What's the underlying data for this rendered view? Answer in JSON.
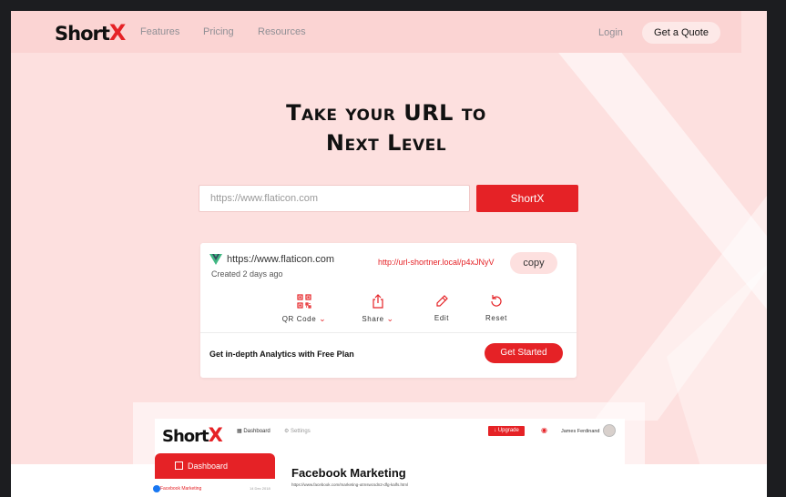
{
  "nav": {
    "logo_text": "Short",
    "logo_x": "X",
    "links": [
      "Features",
      "Pricing",
      "Resources"
    ],
    "login": "Login",
    "quote": "Get a Quote"
  },
  "hero": {
    "title_line1": "Take your URL to",
    "title_line2": "Next Level",
    "input_placeholder": "https://www.flaticon.com",
    "button": "ShortX"
  },
  "result": {
    "original_url": "https://www.flaticon.com",
    "created": "Created 2 days ago",
    "short_url": "http://url-shortner.local/p4xJNyV",
    "copy": "copy",
    "actions": [
      {
        "label": "QR Code",
        "icon": "qr-code-icon",
        "has_chevron": true
      },
      {
        "label": "Share",
        "icon": "share-icon",
        "has_chevron": true
      },
      {
        "label": "Edit",
        "icon": "edit-icon",
        "has_chevron": false
      },
      {
        "label": "Reset",
        "icon": "reset-icon",
        "has_chevron": false
      }
    ],
    "promo": "Get in-depth Analytics with Free Plan",
    "cta": "Get Started"
  },
  "preview": {
    "logo_text": "Short",
    "logo_x": "X",
    "nav_dashboard": "Dashboard",
    "nav_settings": "Settings",
    "upgrade": "Upgrade",
    "user": "James Ferdinand",
    "sidebar_dashboard": "Dashboard",
    "list_item": "Facebook Marketing",
    "list_date": "14 Dec 2018",
    "title": "Facebook Marketing",
    "subtitle": "https://www.facebook.com/marketing-utmswcsdn2-dfg-kalfs.html"
  },
  "colors": {
    "accent": "#e52226",
    "background": "#fde0df",
    "nav_background": "#fbd4d3"
  }
}
